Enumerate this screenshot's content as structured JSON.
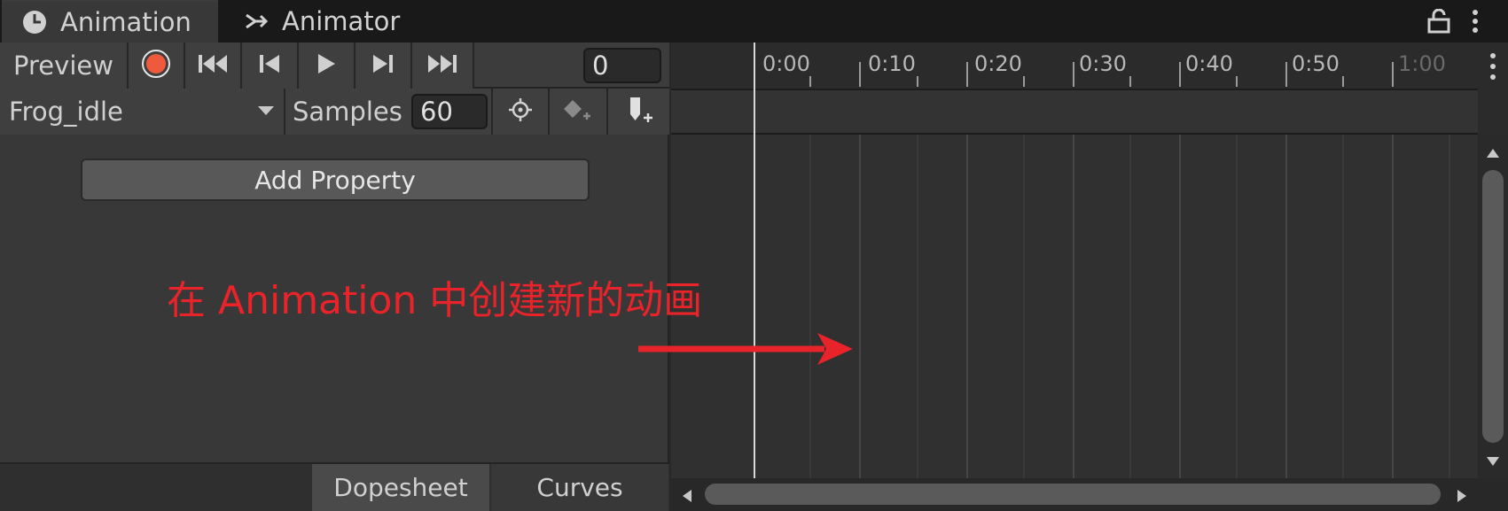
{
  "tabs": [
    {
      "label": "Animation",
      "icon": "clock-icon",
      "active": true
    },
    {
      "label": "Animator",
      "icon": "animator-icon",
      "active": false
    }
  ],
  "toolbar": {
    "preview_label": "Preview",
    "frame_value": "0"
  },
  "clip": {
    "name": "Frog_idle",
    "samples_label": "Samples",
    "samples_value": "60"
  },
  "add_property_label": "Add Property",
  "bottom_tabs": {
    "dopesheet": "Dopesheet",
    "curves": "Curves"
  },
  "ruler_labels": [
    "0:00",
    "0:10",
    "0:20",
    "0:30",
    "0:40",
    "0:50",
    "1:00"
  ],
  "annotation": {
    "text": "在 Animation 中创建新的动画",
    "color": "#e8232a"
  },
  "colors": {
    "record_accent": "#f05a3c",
    "panel_bg": "#383838",
    "timeline_bg": "#303030"
  }
}
